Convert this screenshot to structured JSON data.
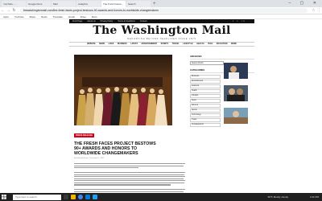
{
  "browser": {
    "tabs": [
      {
        "label": "YouTube - ...",
        "active": false
      },
      {
        "label": "Google Docs",
        "active": false
      },
      {
        "label": "Mail",
        "active": false
      },
      {
        "label": "Analytics",
        "active": false
      },
      {
        "label": "The Fresh Faces...",
        "active": true
      },
      {
        "label": "Search",
        "active": false
      }
    ],
    "new_tab": "+",
    "window_controls": "– ▢ ✕",
    "url": "thewashingtonmail.com/the-fresh-faces-project-bestows-90-awards-and-honors-to-worldwide-changemakers"
  },
  "bookmarks": [
    "Apps",
    "YouTube",
    "Maps",
    "News",
    "Translate",
    "Gmail",
    "Drive",
    "Docs"
  ],
  "site": {
    "topstrip_links": [
      "Front Page",
      "About Us",
      "Privacy Policy",
      "Terms & Conditions",
      "Contact"
    ],
    "social": "f t in",
    "logo": "The Washington Mail",
    "tagline": "REPORTING BEYOND HEADLINES SINCE 1875",
    "nav": [
      "WEBSITE",
      "NEWS",
      "LIVES",
      "BUSINESS",
      "LATEST",
      "ENTERTAINMENT",
      "SPORTS",
      "TRAVEL",
      "LIFESTYLE",
      "HEALTH",
      "TECH",
      "EDUCATION",
      "MORE"
    ]
  },
  "article": {
    "badge": "PRESS RELEASE",
    "headline": "THE FRESH FACES PROJECT BESTOWS 90+ AWARDS AND HONORS TO WORLDWIDE CHANGEMAKERS",
    "byline": "By Editorial Board · December 7, 2022"
  },
  "sidebar": {
    "archives_title": "ARCHIVES",
    "archives_select": "Select Month",
    "categories_title": "CATEGORIES",
    "categories": [
      "Business",
      "Entertainment",
      "Featured",
      "Health",
      "Lifestyle",
      "News",
      "Science",
      "Sports",
      "Technology",
      "Travel",
      "Uncategorized"
    ]
  },
  "taskbar": {
    "search_placeholder": "Type here to search",
    "weather": "65°F Mostly cloudy",
    "time": "3:11 PM"
  }
}
